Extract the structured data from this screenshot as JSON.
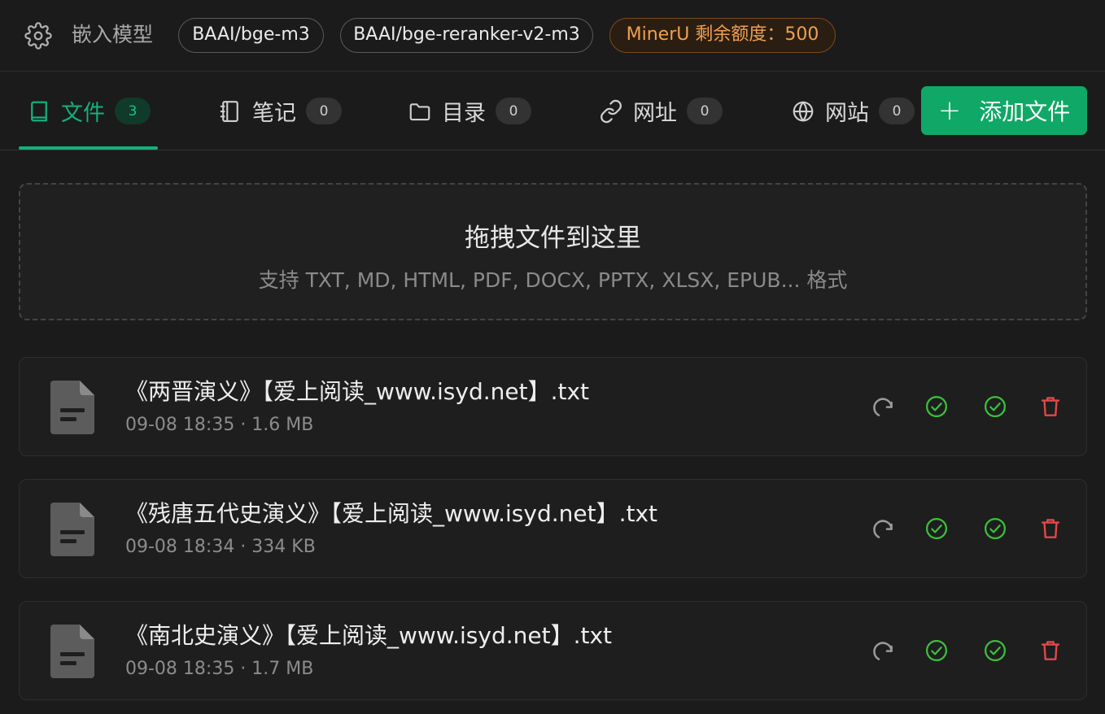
{
  "header": {
    "embed_label": "嵌入模型",
    "models": [
      "BAAI/bge-m3",
      "BAAI/bge-reranker-v2-m3"
    ],
    "quota": "MinerU 剩余额度：500"
  },
  "tabs": [
    {
      "label": "文件",
      "count": "3",
      "icon": "book-icon",
      "active": true
    },
    {
      "label": "笔记",
      "count": "0",
      "icon": "notebook-icon",
      "active": false
    },
    {
      "label": "目录",
      "count": "0",
      "icon": "folder-icon",
      "active": false
    },
    {
      "label": "网址",
      "count": "0",
      "icon": "link-icon",
      "active": false
    },
    {
      "label": "网站",
      "count": "0",
      "icon": "globe-icon",
      "active": false
    }
  ],
  "add_button": {
    "label": "添加文件"
  },
  "dropzone": {
    "title": "拖拽文件到这里",
    "subtitle": "支持 TXT, MD, HTML, PDF, DOCX, PPTX, XLSX, EPUB... 格式"
  },
  "files": [
    {
      "name": "《两晋演义》【爱上阅读_www.isyd.net】.txt",
      "meta": "09-08 18:35 · 1.6 MB"
    },
    {
      "name": "《残唐五代史演义》【爱上阅读_www.isyd.net】.txt",
      "meta": "09-08 18:34 · 334 KB"
    },
    {
      "name": "《南北史演义》【爱上阅读_www.isyd.net】.txt",
      "meta": "09-08 18:35 · 1.7 MB"
    }
  ],
  "colors": {
    "accent": "#14b07a",
    "add_button": "#10a866",
    "quota": "#f0a050",
    "ok": "#3cc03c",
    "delete": "#e0484a"
  }
}
